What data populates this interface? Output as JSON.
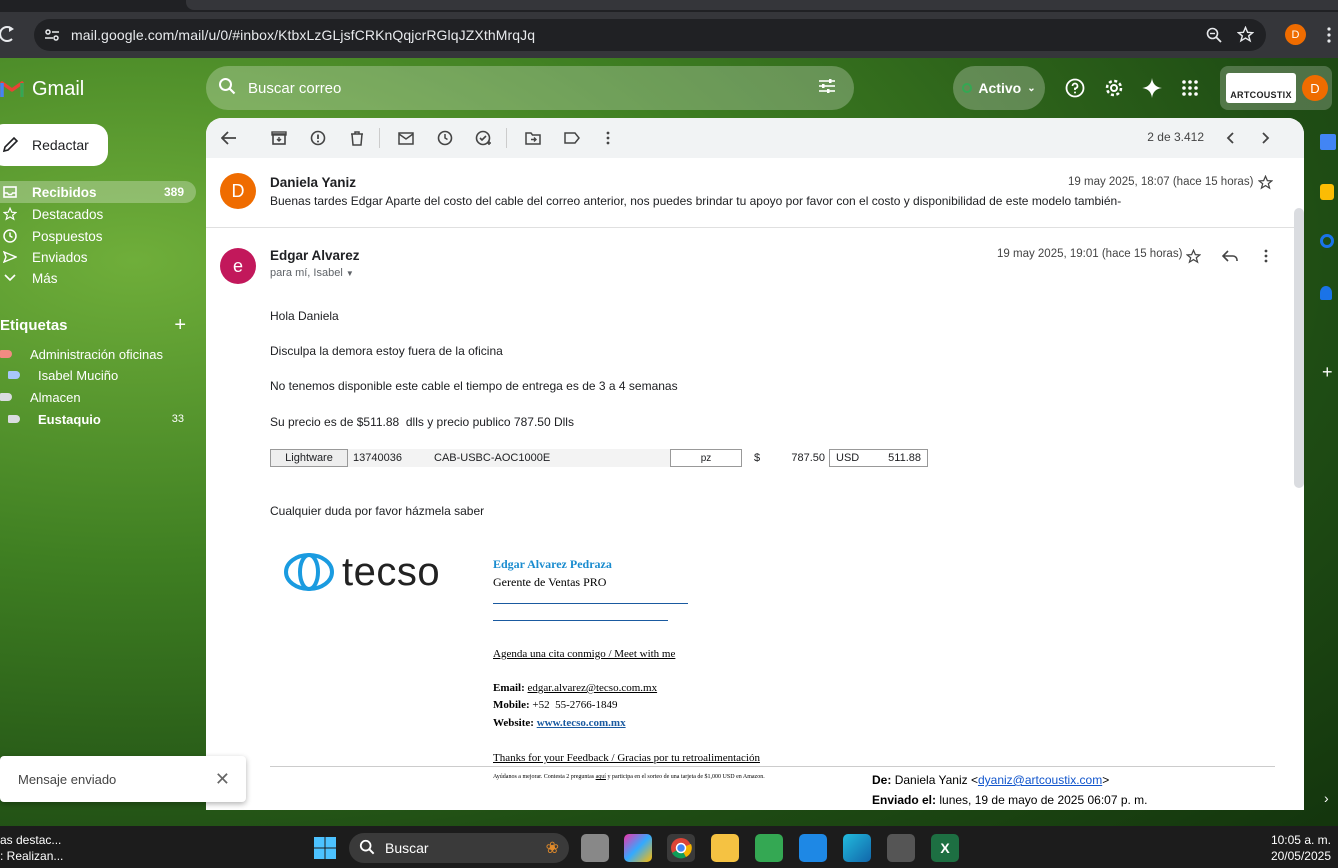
{
  "browser": {
    "url": "mail.google.com/mail/u/0/#inbox/KtbxLzGLjsfCRKnQqjcrRGlqJZXthMrqJq",
    "profile_initial": "D"
  },
  "gmail": {
    "brand": "Gmail",
    "search_placeholder": "Buscar correo",
    "status": "Activo",
    "account_logo_text": "ARTCOUSTIX",
    "account_initial": "D"
  },
  "sidebar": {
    "compose": "Redactar",
    "items": [
      {
        "label": "Recibidos",
        "count": "389",
        "icon": "inbox-icon"
      },
      {
        "label": "Destacados",
        "count": "",
        "icon": "star-icon"
      },
      {
        "label": "Pospuestos",
        "count": "",
        "icon": "clock-icon"
      },
      {
        "label": "Enviados",
        "count": "",
        "icon": "send-icon"
      },
      {
        "label": "Más",
        "count": "",
        "icon": "chevron-down-icon"
      }
    ],
    "labels_title": "Etiquetas",
    "labels": [
      {
        "label": "Administración oficinas",
        "count": "",
        "color": "#f28b82"
      },
      {
        "label": "Isabel Muciño",
        "count": "",
        "color": "#a8c7fa"
      },
      {
        "label": "Almacen",
        "count": "",
        "color": "#dadce0"
      },
      {
        "label": "Eustaquio",
        "count": "33",
        "color": "#dadce0"
      }
    ]
  },
  "toolbar": {
    "pager": "2 de 3.412"
  },
  "thread": {
    "message1": {
      "initial": "D",
      "sender": "Daniela Yaniz",
      "date": "19 may 2025, 18:07 (hace 15 horas)",
      "snippet": "Buenas tardes Edgar Aparte del costo del cable del correo anterior, nos puedes brindar tu apoyo por favor con el costo y disponibilidad de este modelo también-"
    },
    "message2": {
      "initial": "e",
      "sender": "Edgar Alvarez",
      "recipient": "para mí, Isabel",
      "date": "19 may 2025, 19:01 (hace 15 horas)",
      "lines": [
        "Hola Daniela",
        "Disculpa la demora estoy fuera de la oficina",
        "No tenemos disponible este cable el tiempo de entrega es de 3 a 4 semanas",
        "Su precio es de $511.88  dlls y precio publico 787.50 Dlls"
      ],
      "table": {
        "brand": "Lightware",
        "code": "13740036",
        "model": "CAB-USBC-AOC1000E",
        "unit": "pz",
        "currency1": "$",
        "price1": "787.50",
        "currency2": "USD",
        "price2": "511.88"
      },
      "closing": "Cualquier duda por favor házmela saber",
      "signature": {
        "logo": "tecso",
        "name": "Edgar Alvarez Pedraza",
        "title": "Gerente de Ventas PRO",
        "agenda": "Agenda una cita conmigo / Meet with me",
        "email_label": "Email:",
        "email": "edgar.alvarez@tecso.com.mx",
        "mobile_label": "Mobile:",
        "mobile": "+52  55-2766-1849",
        "website_label": "Website:",
        "website": "www.tecso.com.mx",
        "feedback": "Thanks for your Feedback / Gracias por tu retroalimentación",
        "survey_prefix": "Ayúdanos a mejorar. Contesta 2 preguntas",
        "survey_link": "aquí",
        "survey_suffix": "y participa en el sorteo de una tarjeta de $1,000 USD en Amazon."
      },
      "quoted": {
        "from_label": "De:",
        "from_name": "Daniela Yaniz <",
        "from_email": "dyaniz@artcoustix.com",
        "from_close": ">",
        "sent_label": "Enviado el:",
        "sent": "lunes, 19 de mayo de 2025 06:07 p. m."
      }
    }
  },
  "toast": {
    "text": "Mensaje enviado"
  },
  "taskbar": {
    "left_line1": "as destac...",
    "left_line2": ": Realizan...",
    "search": "Buscar",
    "time": "10:05 a. m.",
    "date": "20/05/2025"
  }
}
